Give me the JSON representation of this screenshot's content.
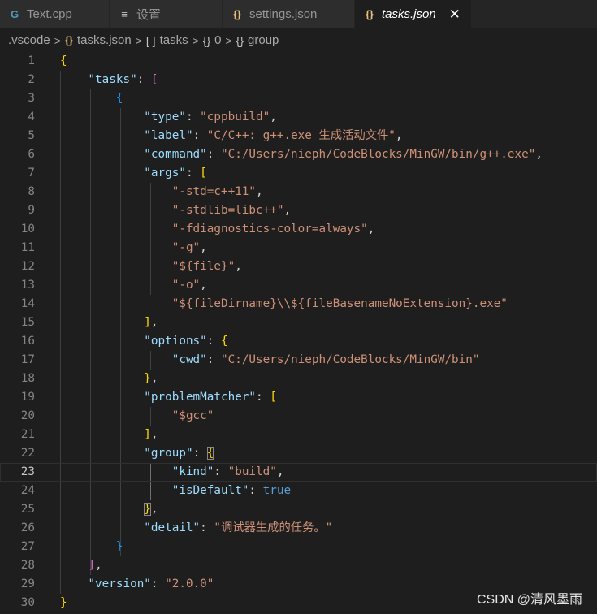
{
  "tabs": [
    {
      "label": "Text.cpp",
      "icon": "cpp-file-icon",
      "glyph": "G"
    },
    {
      "label": "设置",
      "icon": "settings-file-icon",
      "glyph": "≡"
    },
    {
      "label": "settings.json",
      "icon": "json-file-icon",
      "glyph": "{}"
    },
    {
      "label": "tasks.json",
      "icon": "json-file-icon",
      "glyph": "{}",
      "close": "✕"
    }
  ],
  "breadcrumb": {
    "folder": ".vscode",
    "file_icon": "{}",
    "file": "tasks.json",
    "arr_icon": "[ ]",
    "arr": "tasks",
    "obj_icon": "{}",
    "idx": "0",
    "obj2_icon": "{}",
    "group": "group"
  },
  "current_line": 23,
  "lines": [
    [
      [
        "b1",
        "{"
      ]
    ],
    [
      [
        "p",
        "    "
      ],
      [
        "k",
        "\"tasks\""
      ],
      [
        "p",
        ": "
      ],
      [
        "b2",
        "["
      ]
    ],
    [
      [
        "p",
        "        "
      ],
      [
        "b3",
        "{"
      ]
    ],
    [
      [
        "p",
        "            "
      ],
      [
        "k",
        "\"type\""
      ],
      [
        "p",
        ": "
      ],
      [
        "s",
        "\"cppbuild\""
      ],
      [
        "p",
        ","
      ]
    ],
    [
      [
        "p",
        "            "
      ],
      [
        "k",
        "\"label\""
      ],
      [
        "p",
        ": "
      ],
      [
        "s",
        "\"C/C++: g++.exe 生成活动文件\""
      ],
      [
        "p",
        ","
      ]
    ],
    [
      [
        "p",
        "            "
      ],
      [
        "k",
        "\"command\""
      ],
      [
        "p",
        ": "
      ],
      [
        "s",
        "\"C:/Users/nieph/CodeBlocks/MinGW/bin/g++.exe\""
      ],
      [
        "p",
        ","
      ]
    ],
    [
      [
        "p",
        "            "
      ],
      [
        "k",
        "\"args\""
      ],
      [
        "p",
        ": "
      ],
      [
        "b1",
        "["
      ]
    ],
    [
      [
        "p",
        "                "
      ],
      [
        "s",
        "\"-std=c++11\""
      ],
      [
        "p",
        ","
      ]
    ],
    [
      [
        "p",
        "                "
      ],
      [
        "s",
        "\"-stdlib=libc++\""
      ],
      [
        "p",
        ","
      ]
    ],
    [
      [
        "p",
        "                "
      ],
      [
        "s",
        "\"-fdiagnostics-color=always\""
      ],
      [
        "p",
        ","
      ]
    ],
    [
      [
        "p",
        "                "
      ],
      [
        "s",
        "\"-g\""
      ],
      [
        "p",
        ","
      ]
    ],
    [
      [
        "p",
        "                "
      ],
      [
        "s",
        "\"${file}\""
      ],
      [
        "p",
        ","
      ]
    ],
    [
      [
        "p",
        "                "
      ],
      [
        "s",
        "\"-o\""
      ],
      [
        "p",
        ","
      ]
    ],
    [
      [
        "p",
        "                "
      ],
      [
        "s",
        "\"${fileDirname}\\\\${fileBasenameNoExtension}.exe\""
      ]
    ],
    [
      [
        "p",
        "            "
      ],
      [
        "b1",
        "]"
      ],
      [
        "p",
        ","
      ]
    ],
    [
      [
        "p",
        "            "
      ],
      [
        "k",
        "\"options\""
      ],
      [
        "p",
        ": "
      ],
      [
        "b1",
        "{"
      ]
    ],
    [
      [
        "p",
        "                "
      ],
      [
        "k",
        "\"cwd\""
      ],
      [
        "p",
        ": "
      ],
      [
        "s",
        "\"C:/Users/nieph/CodeBlocks/MinGW/bin\""
      ]
    ],
    [
      [
        "p",
        "            "
      ],
      [
        "b1",
        "}"
      ],
      [
        "p",
        ","
      ]
    ],
    [
      [
        "p",
        "            "
      ],
      [
        "k",
        "\"problemMatcher\""
      ],
      [
        "p",
        ": "
      ],
      [
        "b1",
        "["
      ]
    ],
    [
      [
        "p",
        "                "
      ],
      [
        "s",
        "\"$gcc\""
      ]
    ],
    [
      [
        "p",
        "            "
      ],
      [
        "b1",
        "]"
      ],
      [
        "p",
        ","
      ]
    ],
    [
      [
        "p",
        "            "
      ],
      [
        "k",
        "\"group\""
      ],
      [
        "p",
        ": "
      ],
      [
        "b1m",
        "{"
      ]
    ],
    [
      [
        "p",
        "                "
      ],
      [
        "k",
        "\"kind\""
      ],
      [
        "p",
        ": "
      ],
      [
        "s",
        "\"build\""
      ],
      [
        "p",
        ","
      ]
    ],
    [
      [
        "p",
        "                "
      ],
      [
        "k",
        "\"isDefault\""
      ],
      [
        "p",
        ": "
      ],
      [
        "kw",
        "true"
      ]
    ],
    [
      [
        "p",
        "            "
      ],
      [
        "b1m",
        "}"
      ],
      [
        "p",
        ","
      ]
    ],
    [
      [
        "p",
        "            "
      ],
      [
        "k",
        "\"detail\""
      ],
      [
        "p",
        ": "
      ],
      [
        "s",
        "\"调试器生成的任务。\""
      ]
    ],
    [
      [
        "p",
        "        "
      ],
      [
        "b3",
        "}"
      ]
    ],
    [
      [
        "p",
        "    "
      ],
      [
        "b2",
        "]"
      ],
      [
        "p",
        ","
      ]
    ],
    [
      [
        "p",
        "    "
      ],
      [
        "k",
        "\"version\""
      ],
      [
        "p",
        ": "
      ],
      [
        "s",
        "\"2.0.0\""
      ]
    ],
    [
      [
        "b1",
        "}"
      ]
    ]
  ],
  "watermark": "CSDN @清风墨雨",
  "colors": {
    "background": "#1e1e1e",
    "key": "#9cdcfe",
    "string": "#ce9178",
    "bracket_gold": "#ffd700",
    "bracket_purple": "#da70d6",
    "bracket_blue": "#179fff",
    "keyword": "#569cd6"
  }
}
